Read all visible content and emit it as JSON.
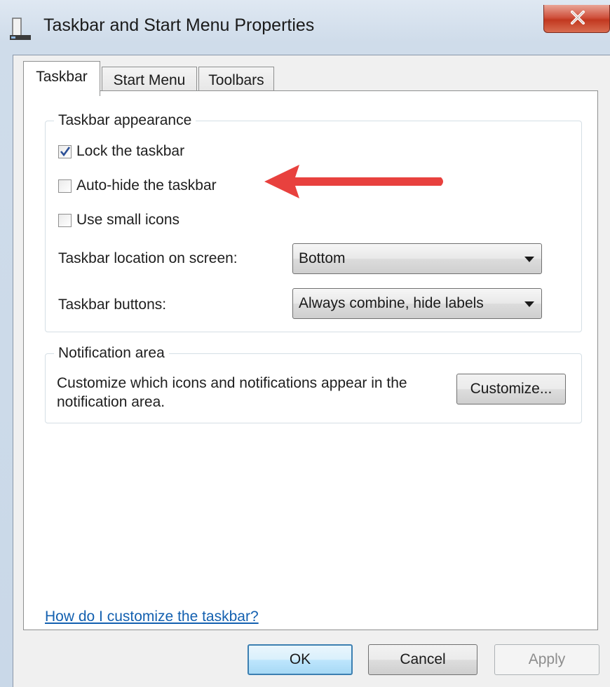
{
  "window": {
    "title": "Taskbar and Start Menu Properties",
    "close_label": "X"
  },
  "tabs": [
    {
      "label": "Taskbar",
      "active": true
    },
    {
      "label": "Start Menu",
      "active": false
    },
    {
      "label": "Toolbars",
      "active": false
    }
  ],
  "appearance": {
    "legend": "Taskbar appearance",
    "lock_taskbar": {
      "label": "Lock the taskbar",
      "checked": true
    },
    "auto_hide": {
      "label": "Auto-hide the taskbar",
      "checked": false
    },
    "small_icons": {
      "label": "Use small icons",
      "checked": false
    },
    "location_label": "Taskbar location on screen:",
    "location_value": "Bottom",
    "buttons_label": "Taskbar buttons:",
    "buttons_value": "Always combine, hide labels"
  },
  "notification": {
    "legend": "Notification area",
    "description": "Customize which icons and notifications appear in the notification area.",
    "customize_label": "Customize..."
  },
  "help_link": "How do I customize the taskbar?",
  "footer": {
    "ok_label": "OK",
    "cancel_label": "Cancel",
    "apply_label": "Apply"
  },
  "colors": {
    "annotation_arrow": "#e8413e",
    "link": "#1360b0",
    "close_button": "#c23820"
  },
  "icons": {
    "app": "taskbar-window-icon",
    "close": "close-x-icon",
    "check": "checkmark-icon",
    "dropdown": "dropdown-arrow-icon",
    "annotation": "red-arrow-icon"
  }
}
